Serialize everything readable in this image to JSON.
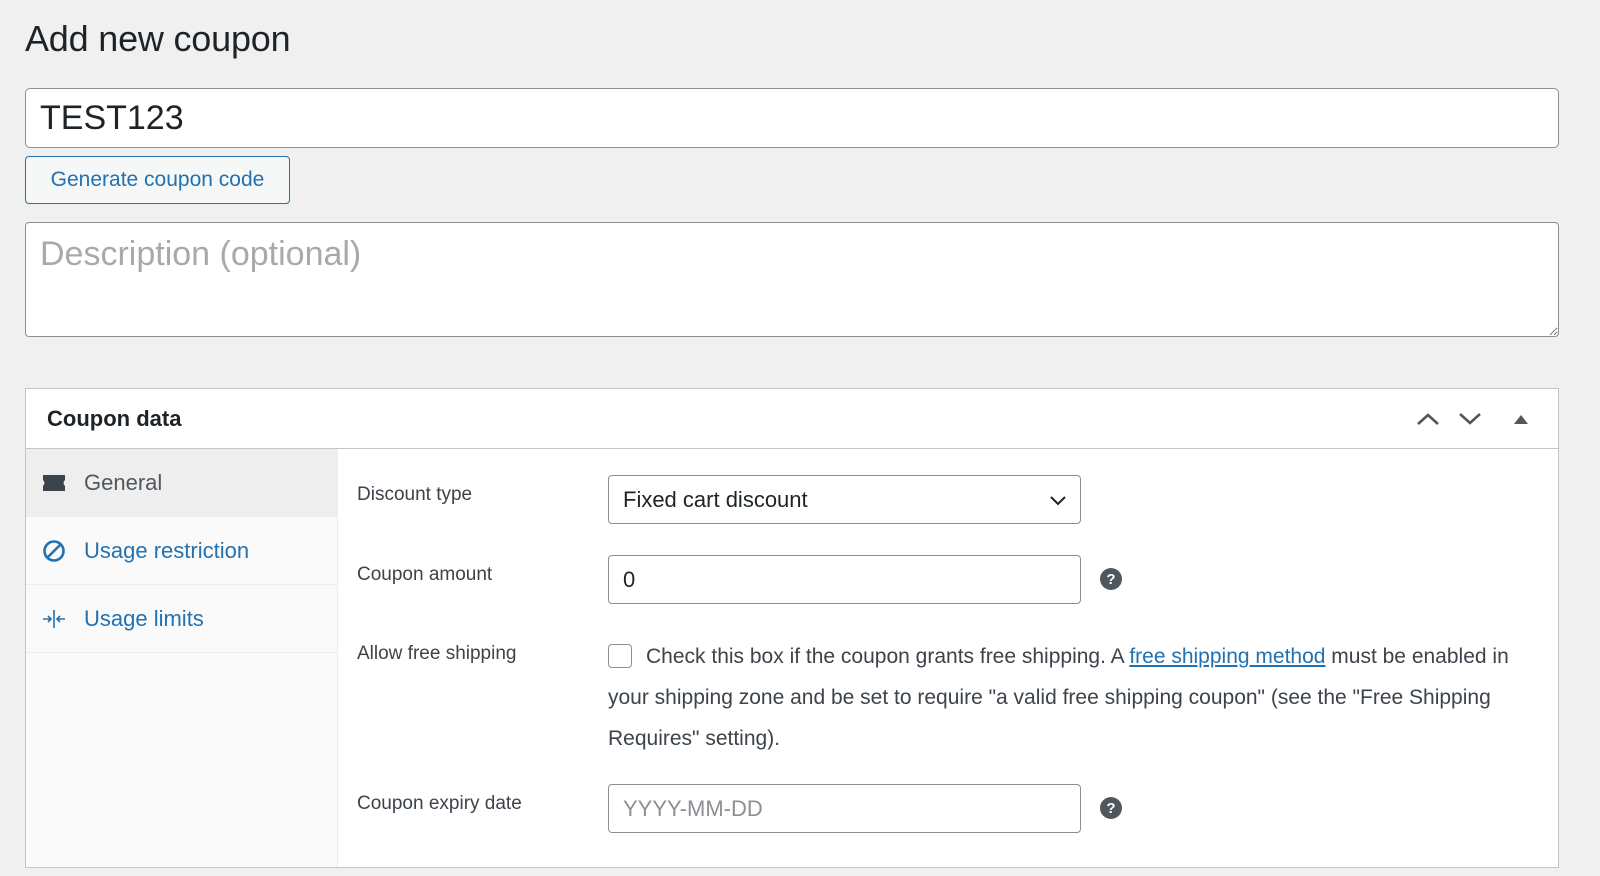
{
  "page": {
    "title": "Add new coupon"
  },
  "coupon_code": {
    "value": "TEST123"
  },
  "generate_button": {
    "label": "Generate coupon code"
  },
  "description": {
    "placeholder": "Description (optional)"
  },
  "coupon_data": {
    "title": "Coupon data",
    "header_controls": [
      "chevron-up-icon",
      "chevron-down-icon",
      "triangle-up-icon"
    ],
    "tabs": [
      {
        "label": "General",
        "icon": "ticket-icon",
        "active": true
      },
      {
        "label": "Usage restriction",
        "icon": "no-entry-icon",
        "active": false
      },
      {
        "label": "Usage limits",
        "icon": "arrows-in-icon",
        "active": false
      }
    ],
    "general": {
      "discount_type": {
        "label": "Discount type",
        "selected": "Fixed cart discount"
      },
      "coupon_amount": {
        "label": "Coupon amount",
        "value": "0"
      },
      "free_shipping": {
        "label": "Allow free shipping",
        "checked": false,
        "desc_before": "Check this box if the coupon grants free shipping. A ",
        "link_text": "free shipping method",
        "desc_after": " must be enabled in your shipping zone and be set to require \"a valid free shipping coupon\" (see the \"Free Shipping Requires\" setting)."
      },
      "expiry_date": {
        "label": "Coupon expiry date",
        "placeholder": "YYYY-MM-DD"
      },
      "help_glyph": "?"
    }
  },
  "colors": {
    "link": "#2271b1",
    "background": "#f0f0f1",
    "border": "#c3c4c7"
  }
}
